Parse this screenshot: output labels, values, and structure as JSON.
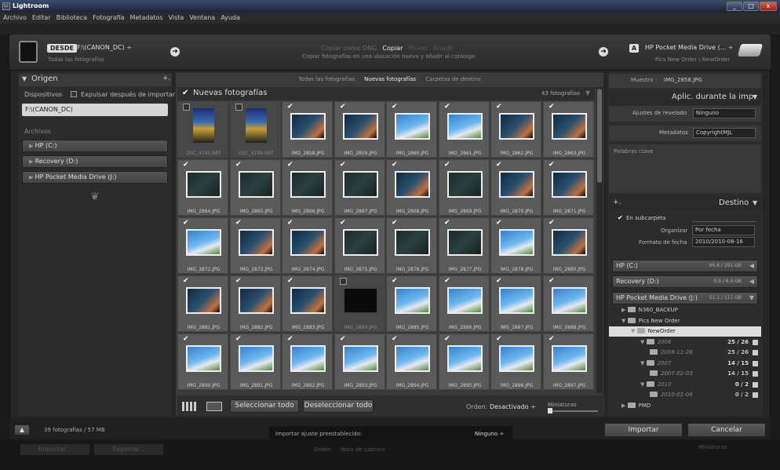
{
  "window": {
    "title": "Lightroom",
    "min": "_",
    "max": "□",
    "close": "x"
  },
  "menu": [
    "Archivo",
    "Editar",
    "Biblioteca",
    "Fotografía",
    "Metadatos",
    "Vista",
    "Ventana",
    "Ayuda"
  ],
  "header": {
    "desde_label": "DESDE",
    "source_path": "F:\\(CANON_DC) ÷",
    "source_sub": "Todas las fotografías",
    "modes": [
      "Copiar como DNG",
      "Copiar",
      "Mover",
      "Añadir"
    ],
    "mode_desc": "Copiar fotografías en una ubicación nueva y añadir al catálogo",
    "dest_label": "A",
    "dest_name": "HP Pocket Media Drive (... ÷",
    "dest_sub": "Pics New Order \\ NewOrder"
  },
  "left": {
    "section": "Origen",
    "add": "+.",
    "devices_label": "Dispositivos",
    "eject_label": "Expulsar después de importar",
    "selected_device": "F:\\(CANON_DC)",
    "files_label": "Archivos",
    "drives": [
      "HP (C:)",
      "Recovery (D:)",
      "HP Pocket Media Drive (J:)"
    ]
  },
  "center": {
    "tabs": [
      "Todas las fotografías",
      "Nuevas fotografías",
      "Carpetas de destino"
    ],
    "active_tab": 1,
    "grid_title": "Nuevas fotografías",
    "count": "43 fotografías",
    "photos": [
      {
        "name": "DSC_4795.NEF",
        "checked": false,
        "kind": "portrait"
      },
      {
        "name": "DSC_4799.NEF",
        "checked": false,
        "kind": "portrait"
      },
      {
        "name": "IMG_2858.JPG",
        "checked": true,
        "kind": "night"
      },
      {
        "name": "IMG_2859.JPG",
        "checked": true,
        "kind": "night"
      },
      {
        "name": "IMG_2860.JPG",
        "checked": true,
        "kind": "pool"
      },
      {
        "name": "IMG_2861.JPG",
        "checked": true,
        "kind": "pool"
      },
      {
        "name": "IMG_2862.JPG",
        "checked": true,
        "kind": "night"
      },
      {
        "name": "IMG_2863.JPG",
        "checked": true,
        "kind": "night"
      },
      {
        "name": "IMG_2864.JPG",
        "checked": true,
        "kind": "dark"
      },
      {
        "name": "IMG_2865.JPG",
        "checked": true,
        "kind": "dark"
      },
      {
        "name": "IMG_2866.JPG",
        "checked": true,
        "kind": "dark"
      },
      {
        "name": "IMG_2867.JPG",
        "checked": true,
        "kind": "dark"
      },
      {
        "name": "IMG_2868.JPG",
        "checked": true,
        "kind": "night"
      },
      {
        "name": "IMG_2869.JPG",
        "checked": true,
        "kind": "dark"
      },
      {
        "name": "IMG_2870.JPG",
        "checked": true,
        "kind": "night"
      },
      {
        "name": "IMG_2871.JPG",
        "checked": true,
        "kind": "night"
      },
      {
        "name": "IMG_2872.JPG",
        "checked": true,
        "kind": "pool"
      },
      {
        "name": "IMG_2873.JPG",
        "checked": true,
        "kind": "night"
      },
      {
        "name": "IMG_2874.JPG",
        "checked": true,
        "kind": "night"
      },
      {
        "name": "IMG_2875.JPG",
        "checked": true,
        "kind": "dark"
      },
      {
        "name": "IMG_2876.JPG",
        "checked": true,
        "kind": "dark"
      },
      {
        "name": "IMG_2877.JPG",
        "checked": true,
        "kind": "dark"
      },
      {
        "name": "IMG_2878.JPG",
        "checked": true,
        "kind": "pool"
      },
      {
        "name": "IMG_2880.JPG",
        "checked": true,
        "kind": "night"
      },
      {
        "name": "IMG_2881.JPG",
        "checked": true,
        "kind": "night"
      },
      {
        "name": "IMG_2882.JPG",
        "checked": true,
        "kind": "night"
      },
      {
        "name": "IMG_2883.JPG",
        "checked": true,
        "kind": "night"
      },
      {
        "name": "IMG_2884.JPG",
        "checked": false,
        "kind": "blank"
      },
      {
        "name": "IMG_2885.JPG",
        "checked": true,
        "kind": "pool"
      },
      {
        "name": "IMG_2886.JPG",
        "checked": true,
        "kind": "pool"
      },
      {
        "name": "IMG_2887.JPG",
        "checked": true,
        "kind": "pool"
      },
      {
        "name": "IMG_2888.JPG",
        "checked": true,
        "kind": "pool"
      },
      {
        "name": "IMG_2890.JPG",
        "checked": true,
        "kind": "pool"
      },
      {
        "name": "IMG_2891.JPG",
        "checked": true,
        "kind": "pool"
      },
      {
        "name": "IMG_2892.JPG",
        "checked": true,
        "kind": "pool"
      },
      {
        "name": "IMG_2893.JPG",
        "checked": true,
        "kind": "pool"
      },
      {
        "name": "IMG_2894.JPG",
        "checked": true,
        "kind": "pool"
      },
      {
        "name": "IMG_2895.JPG",
        "checked": true,
        "kind": "pool"
      },
      {
        "name": "IMG_2896.JPG",
        "checked": true,
        "kind": "pool"
      },
      {
        "name": "IMG_2897.JPG",
        "checked": true,
        "kind": "pool"
      }
    ],
    "select_all": "Seleccionar todo",
    "deselect_all": "Deseleccionar todo",
    "order_label": "Orden:",
    "order_value": "Desactivado ÷",
    "thumbs_label": "Miniaturas"
  },
  "right": {
    "sample_label": "Muestra :",
    "sample_value": "IMG_2858.JPG",
    "apply_title": "Aplic. durante la imp.",
    "develop_label": "Ajustes de revelado",
    "develop_value": "Ninguno",
    "metadata_label": "Metadatos",
    "metadata_value": "CopyrightMJL",
    "keywords_label": "Palabras clave",
    "dest_title": "Destino",
    "dest_add": "+.",
    "subfolder_label": "En subcarpeta",
    "organize_label": "Organizar",
    "organize_value": "Por fecha",
    "datefmt_label": "Formato de fecha",
    "datefmt_value": "2010/2010-08-16",
    "drives": [
      {
        "name": "HP (C:)",
        "size": "96,8 / 291 GB"
      },
      {
        "name": "Recovery (D:)",
        "size": "0,9 / 6,4 GB"
      },
      {
        "name": "HP Pocket Media Drive (J:)",
        "size": "51,1 / 111 GB"
      }
    ],
    "tree": [
      {
        "name": "N360_BACKUP",
        "level": 0,
        "count": ""
      },
      {
        "name": "Pics New Order",
        "level": 0,
        "count": ""
      },
      {
        "name": "NewOrder",
        "level": 1,
        "count": ""
      },
      {
        "name": "2006",
        "level": 2,
        "count": "25 / 26"
      },
      {
        "name": "2006-11-28",
        "level": 3,
        "count": "25 / 26"
      },
      {
        "name": "2007",
        "level": 2,
        "count": "14 / 15"
      },
      {
        "name": "2007-02-03",
        "level": 3,
        "count": "14 / 15"
      },
      {
        "name": "2010",
        "level": 2,
        "count": "0 / 2"
      },
      {
        "name": "2010-01-06",
        "level": 3,
        "count": "0 / 2"
      },
      {
        "name": "PMD",
        "level": 0,
        "count": ""
      }
    ]
  },
  "footer": {
    "count": "39 fotografías / 57 MB",
    "preset_label": "Importar ajuste preestablecido:",
    "preset_value": "Ninguno ÷",
    "import": "Importar",
    "cancel": "Cancelar"
  },
  "bg": {
    "import": "Importar...",
    "export": "Exportar...",
    "order": "Orden:",
    "order_value": "Hora de captura",
    "thumbs": "Miniaturas"
  }
}
